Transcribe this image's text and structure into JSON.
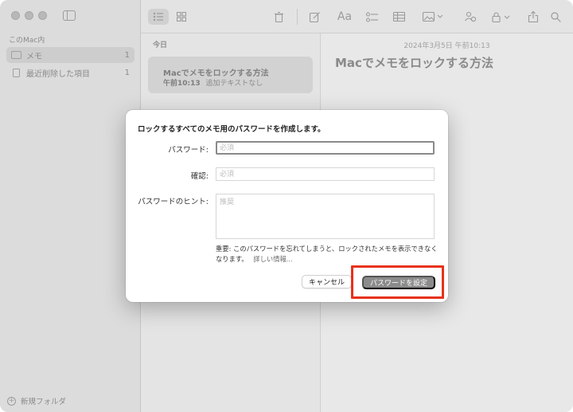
{
  "sidebar": {
    "section_title": "このMac内",
    "items": [
      {
        "label": "メモ",
        "count": "1"
      },
      {
        "label": "最近削除した項目",
        "count": "1"
      }
    ],
    "new_folder_label": "新規フォルダ"
  },
  "toolbar": {
    "font_label": "Aa"
  },
  "note_list": {
    "header": "今日",
    "note": {
      "title": "Macでメモをロックする方法",
      "time": "午前10:13",
      "preview": "追加テキストなし"
    }
  },
  "editor": {
    "date": "2024年3月5日 午前10:13",
    "title": "Macでメモをロックする方法"
  },
  "dialog": {
    "title": "ロックするすべてのメモ用のパスワードを作成します。",
    "password_label": "パスワード:",
    "password_placeholder": "必須",
    "confirm_label": "確認:",
    "confirm_placeholder": "必須",
    "hint_label": "パスワードのヒント:",
    "hint_placeholder": "推奨",
    "warning": "重要: このパスワードを忘れてしまうと、ロックされたメモを表示できなくなります。",
    "more_info": "詳しい情報...",
    "cancel_label": "キャンセル",
    "set_label": "パスワードを設定"
  },
  "colors": {
    "highlight": "#e8311b",
    "default_button": "#8b8b8b"
  }
}
